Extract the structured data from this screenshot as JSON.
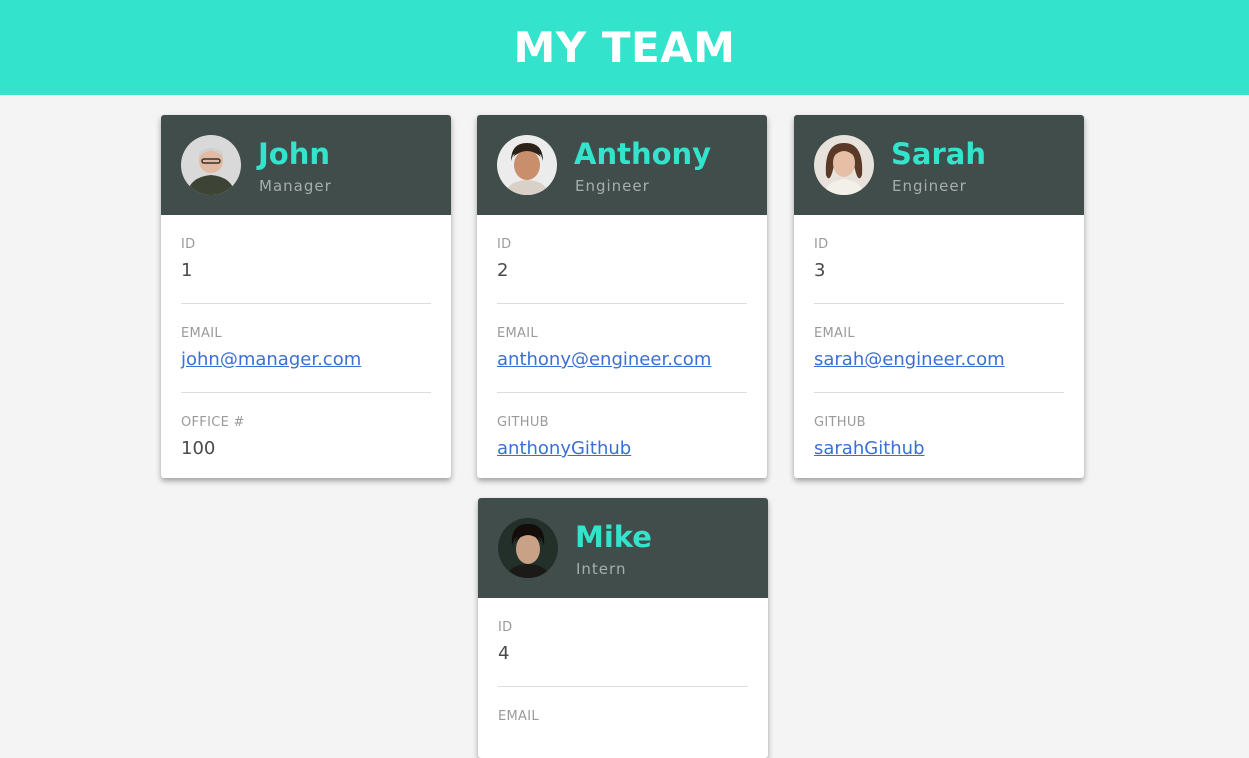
{
  "page": {
    "title": "MY TEAM",
    "accent_color": "#33e3cc",
    "card_header_color": "#404d4b"
  },
  "members": [
    {
      "name": "John",
      "role": "Manager",
      "avatar_icon": "person-photo-avatar",
      "id_label": "ID",
      "id": "1",
      "email_label": "EMAIL",
      "email": "john@manager.com",
      "extra_label": "OFFICE #",
      "extra": "100"
    },
    {
      "name": "Anthony",
      "role": "Engineer",
      "avatar_icon": "person-photo-avatar",
      "id_label": "ID",
      "id": "2",
      "email_label": "EMAIL",
      "email": "anthony@engineer.com",
      "extra_label": "GITHUB",
      "extra": "anthonyGithub"
    },
    {
      "name": "Sarah",
      "role": "Engineer",
      "avatar_icon": "person-photo-avatar",
      "id_label": "ID",
      "id": "3",
      "email_label": "EMAIL",
      "email": "sarah@engineer.com",
      "extra_label": "GITHUB",
      "extra": "sarahGithub"
    },
    {
      "name": "Mike",
      "role": "Intern",
      "avatar_icon": "person-photo-avatar",
      "id_label": "ID",
      "id": "4",
      "email_label": "EMAIL"
    }
  ]
}
